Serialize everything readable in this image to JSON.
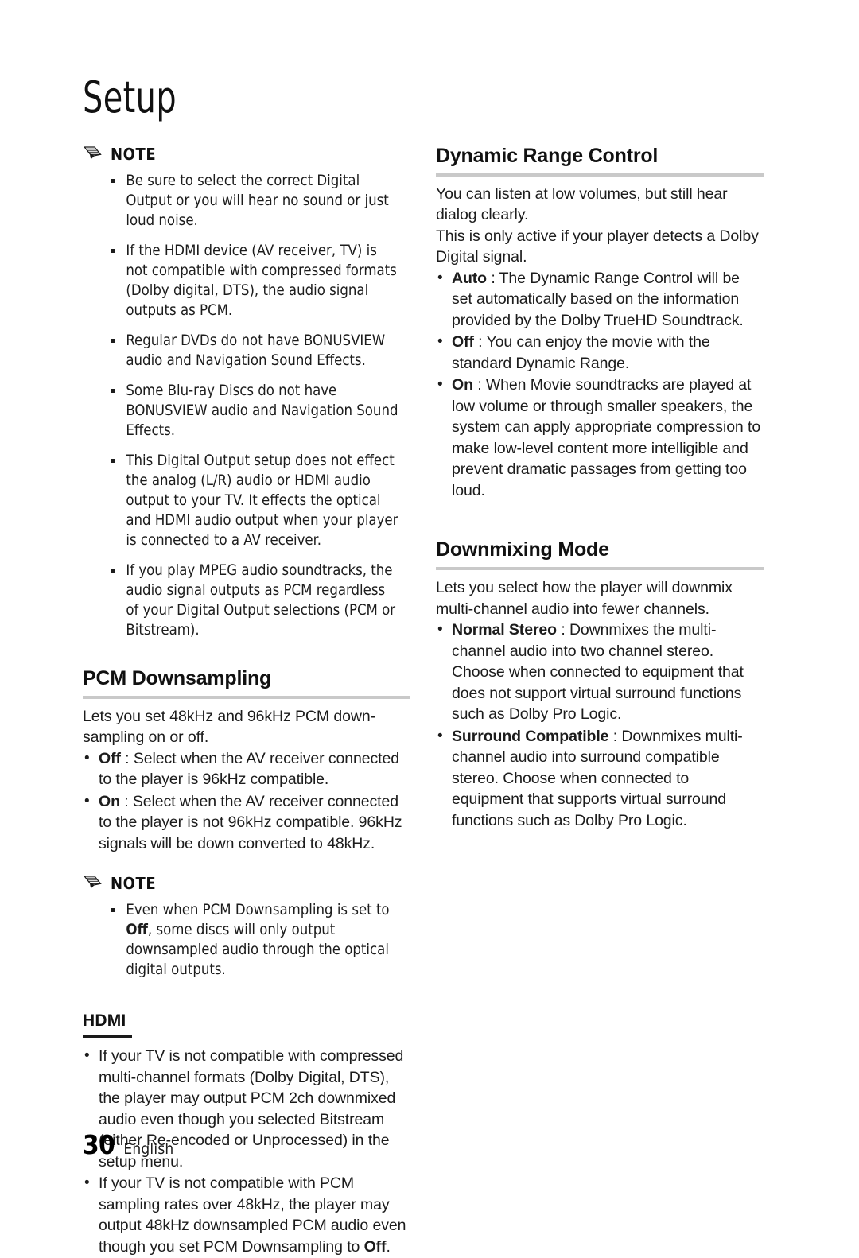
{
  "chapter": {
    "title": "Setup"
  },
  "note_icon_name": "pencil-icon",
  "left_column": {
    "note_1": {
      "label": "NOTE",
      "items": [
        "Be sure to select the correct Digital Output or you will hear no sound or just loud noise.",
        "If the HDMI device (AV receiver, TV) is not compatible with compressed formats (Dolby digital, DTS), the audio signal outputs as PCM.",
        "Regular DVDs do not have BONUSVIEW audio and Navigation Sound Effects.",
        "Some Blu-ray Discs do not have BONUSVIEW audio and Navigation Sound Effects.",
        "This Digital Output setup does not effect the analog (L/R) audio or HDMI audio output to your TV. It effects the optical and HDMI audio output when your player is connected to a AV receiver.",
        "If you play MPEG audio soundtracks, the audio signal outputs as PCM regardless of your Digital Output selections (PCM or Bitstream)."
      ]
    },
    "pcm_downsampling": {
      "heading": "PCM Downsampling",
      "intro": "Lets you set 48kHz and 96kHz PCM down-sampling on or off.",
      "options": [
        {
          "term": "Off",
          "text": " : Select when the AV receiver connected to the player is 96kHz compatible."
        },
        {
          "term": "On",
          "text": " : Select when the AV receiver connected to the player is not 96kHz compatible. 96kHz signals will be down converted to 48kHz."
        }
      ]
    },
    "note_2": {
      "label": "NOTE",
      "item_pre": "Even when PCM Downsampling is set to ",
      "item_bold": "Off",
      "item_post": ", some discs will only output downsampled audio through the optical digital outputs."
    },
    "hdmi": {
      "heading": "HDMI",
      "bullets": [
        {
          "text": "If your TV is not compatible with compressed multi-channel formats (Dolby Digital, DTS), the player may output PCM 2ch downmixed audio even though you selected Bitstream (either Re-encoded or Unprocessed) in the setup menu."
        },
        {
          "pre": "If your TV is not compatible with PCM sampling rates over 48kHz, the player may output 48kHz downsampled PCM audio even though you set PCM Downsampling to ",
          "bold": "Off",
          "post": "."
        }
      ]
    }
  },
  "right_column": {
    "dynamic_range_control": {
      "heading": "Dynamic Range Control",
      "paragraph_1": "You can listen at low volumes, but still hear dialog clearly.",
      "paragraph_2": "This is only active if your player detects a Dolby Digital signal.",
      "options": [
        {
          "term": "Auto",
          "text": " : The Dynamic Range Control will be set automatically based on the information provided by the Dolby TrueHD Soundtrack."
        },
        {
          "term": "Off",
          "text": " : You can enjoy the movie with the standard Dynamic Range."
        },
        {
          "term": "On",
          "text": " : When Movie soundtracks are played at low volume or through smaller speakers, the system can apply appropriate compression to make low-level content more intelligible and prevent dramatic passages from getting too loud."
        }
      ]
    },
    "downmixing_mode": {
      "heading": "Downmixing Mode",
      "intro": "Lets you select how the player will downmix multi-channel audio into fewer channels.",
      "options": [
        {
          "term": "Normal Stereo",
          "text": " : Downmixes the multi-channel audio into two channel stereo. Choose when connected to equipment that does not support virtual surround functions such as Dolby Pro Logic."
        },
        {
          "term": "Surround Compatible",
          "text": " : Downmixes multi-channel audio into surround compatible stereo. Choose when connected to equipment that supports virtual surround functions such as Dolby Pro Logic."
        }
      ]
    }
  },
  "footer": {
    "page_number": "30",
    "language": "English"
  },
  "colors": {
    "text": "#1c1c1c",
    "heading_rule": "#c9c9c9",
    "subhead_rule": "#1a1a1a",
    "background": "#ffffff"
  }
}
